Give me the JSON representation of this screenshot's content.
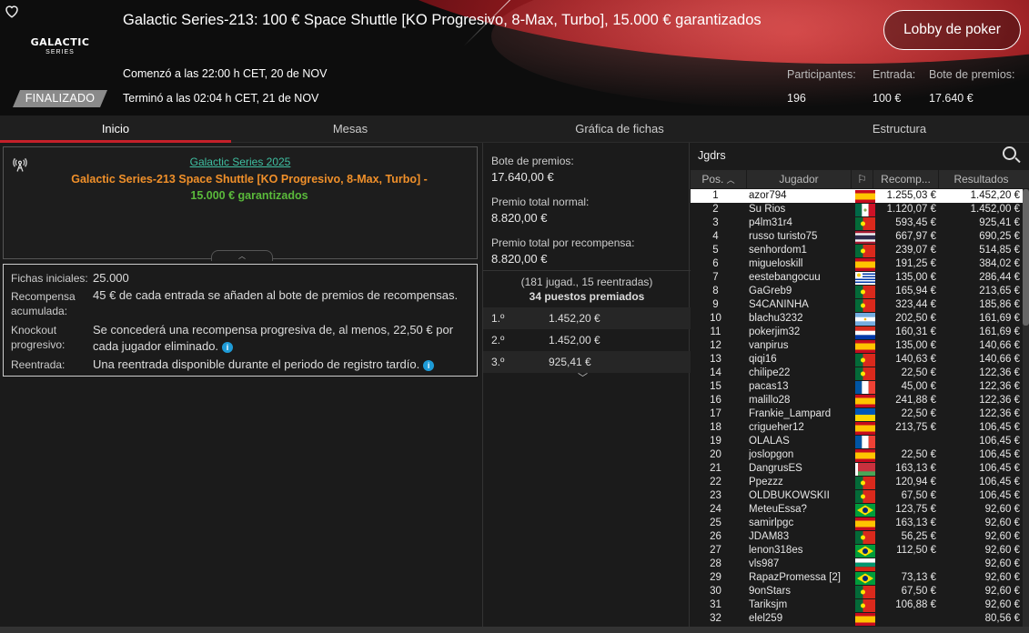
{
  "header": {
    "title": "Galactic Series-213: 100 € Space Shuttle [KO Progresivo, 8-Max, Turbo], 15.000 € garantizados",
    "logo_line1": "GALACTIC",
    "logo_line2": "SERIES",
    "status": "FINALIZADO",
    "started": "Comenzó a las 22:00 h CET, 20 de NOV",
    "ended": "Terminó a las 02:04 h CET, 21 de NOV",
    "lobby_button": "Lobby de poker",
    "stats": {
      "participants_label": "Participantes:",
      "participants": "196",
      "entry_label": "Entrada:",
      "entry": "100 €",
      "prize_label": "Bote de premios:",
      "prize": "17.640 €"
    }
  },
  "tabs": [
    "Inicio",
    "Mesas",
    "Gráfica de fichas",
    "Estructura"
  ],
  "info": {
    "series_link": "Galactic Series 2025",
    "name_part1": "Galactic Series-213 Space Shuttle [KO Progresivo, 8-Max, Turbo]",
    "name_sep": " -",
    "name_part2": "15.000 € garantizados"
  },
  "details": [
    {
      "label": "Fichas iniciales:",
      "value": "25.000"
    },
    {
      "label": "Recompensa acumulada:",
      "value": "45 € de cada entrada se añaden al bote de premios de recompensas."
    },
    {
      "label": "Knockout progresivo:",
      "value": "Se concederá una recompensa progresiva de, al menos, 22,50 € por cada jugador eliminado."
    },
    {
      "label": "Reentrada:",
      "value": "Una reentrada disponible durante el periodo de registro tardío."
    }
  ],
  "prizes": {
    "pool_label": "Bote de premios:",
    "pool": "17.640,00 €",
    "normal_label": "Premio total normal:",
    "normal": "8.820,00 €",
    "bounty_label": "Premio total por recompensa:",
    "bounty": "8.820,00 €",
    "players": "(181 jugad., 15 reentradas)",
    "paid": "34 puestos premiados",
    "places": [
      {
        "pos": "1.º",
        "amount": "1.452,20 €"
      },
      {
        "pos": "2.º",
        "amount": "1.452,00 €"
      },
      {
        "pos": "3.º",
        "amount": "925,41 €"
      }
    ]
  },
  "search": {
    "query": "Jgdrs"
  },
  "table": {
    "headers": {
      "pos": "Pos.",
      "player": "Jugador",
      "bounty": "Recomp...",
      "result": "Resultados"
    },
    "rows": [
      {
        "pos": "1",
        "name": "azor794",
        "flag": "es",
        "bounty": "1.255,03 €",
        "result": "1.452,20 €"
      },
      {
        "pos": "2",
        "name": "Su Rios",
        "flag": "mx",
        "bounty": "1.120,07 €",
        "result": "1.452,00 €"
      },
      {
        "pos": "3",
        "name": "p4lm31r4",
        "flag": "pt",
        "bounty": "593,45 €",
        "result": "925,41 €"
      },
      {
        "pos": "4",
        "name": "russo turisto75",
        "flag": "th",
        "bounty": "667,97 €",
        "result": "690,25 €"
      },
      {
        "pos": "5",
        "name": "senhordom1",
        "flag": "pt",
        "bounty": "239,07 €",
        "result": "514,85 €"
      },
      {
        "pos": "6",
        "name": "migueloskill",
        "flag": "es",
        "bounty": "191,25 €",
        "result": "384,02 €"
      },
      {
        "pos": "7",
        "name": "eestebangocuu",
        "flag": "uy",
        "bounty": "135,00 €",
        "result": "286,44 €"
      },
      {
        "pos": "8",
        "name": "GaGreb9",
        "flag": "pt",
        "bounty": "165,94 €",
        "result": "213,65 €"
      },
      {
        "pos": "9",
        "name": "S4CANINHA",
        "flag": "pt",
        "bounty": "323,44 €",
        "result": "185,86 €"
      },
      {
        "pos": "10",
        "name": "blachu3232",
        "flag": "ar",
        "bounty": "202,50 €",
        "result": "161,69 €"
      },
      {
        "pos": "11",
        "name": "pokerjim32",
        "flag": "py",
        "bounty": "160,31 €",
        "result": "161,69 €"
      },
      {
        "pos": "12",
        "name": "vanpirus",
        "flag": "es",
        "bounty": "135,00 €",
        "result": "140,66 €"
      },
      {
        "pos": "13",
        "name": "qiqi16",
        "flag": "pt",
        "bounty": "140,63 €",
        "result": "140,66 €"
      },
      {
        "pos": "14",
        "name": "chilipe22",
        "flag": "pt",
        "bounty": "22,50 €",
        "result": "122,36 €"
      },
      {
        "pos": "15",
        "name": "pacas13",
        "flag": "fr",
        "bounty": "45,00 €",
        "result": "122,36 €"
      },
      {
        "pos": "16",
        "name": "malillo28",
        "flag": "es",
        "bounty": "241,88 €",
        "result": "122,36 €"
      },
      {
        "pos": "17",
        "name": "Frankie_Lampard",
        "flag": "ua",
        "bounty": "22,50 €",
        "result": "122,36 €"
      },
      {
        "pos": "18",
        "name": "crigueher12",
        "flag": "es",
        "bounty": "213,75 €",
        "result": "106,45 €"
      },
      {
        "pos": "19",
        "name": "OLALAS",
        "flag": "fr",
        "bounty": "",
        "result": "106,45 €"
      },
      {
        "pos": "20",
        "name": "joslopgon",
        "flag": "es",
        "bounty": "22,50 €",
        "result": "106,45 €"
      },
      {
        "pos": "21",
        "name": "DangrusES",
        "flag": "by",
        "bounty": "163,13 €",
        "result": "106,45 €"
      },
      {
        "pos": "22",
        "name": "Ppezzz",
        "flag": "pt",
        "bounty": "120,94 €",
        "result": "106,45 €"
      },
      {
        "pos": "23",
        "name": "OLDBUKOWSKII",
        "flag": "pt",
        "bounty": "67,50 €",
        "result": "106,45 €"
      },
      {
        "pos": "24",
        "name": "MeteuEssa?",
        "flag": "br",
        "bounty": "123,75 €",
        "result": "92,60 €"
      },
      {
        "pos": "25",
        "name": "samirlpgc",
        "flag": "es",
        "bounty": "163,13 €",
        "result": "92,60 €"
      },
      {
        "pos": "26",
        "name": "JDAM83",
        "flag": "pt",
        "bounty": "56,25 €",
        "result": "92,60 €"
      },
      {
        "pos": "27",
        "name": "lenon318es",
        "flag": "br",
        "bounty": "112,50 €",
        "result": "92,60 €"
      },
      {
        "pos": "28",
        "name": "vls987",
        "flag": "bg",
        "bounty": "",
        "result": "92,60 €"
      },
      {
        "pos": "29",
        "name": "RapazPromessa [2]",
        "flag": "br",
        "bounty": "73,13 €",
        "result": "92,60 €"
      },
      {
        "pos": "30",
        "name": "9onStars",
        "flag": "pt",
        "bounty": "67,50 €",
        "result": "92,60 €"
      },
      {
        "pos": "31",
        "name": "Tariksjm",
        "flag": "pt",
        "bounty": "106,88 €",
        "result": "92,60 €"
      },
      {
        "pos": "32",
        "name": "elel259",
        "flag": "es",
        "bounty": "",
        "result": "80,56 €"
      }
    ]
  },
  "colors": {
    "accent": "#c5202a",
    "link": "#3fbfa1",
    "orange": "#f0902a",
    "green": "#5aba3b",
    "info": "#1e9bd7"
  }
}
